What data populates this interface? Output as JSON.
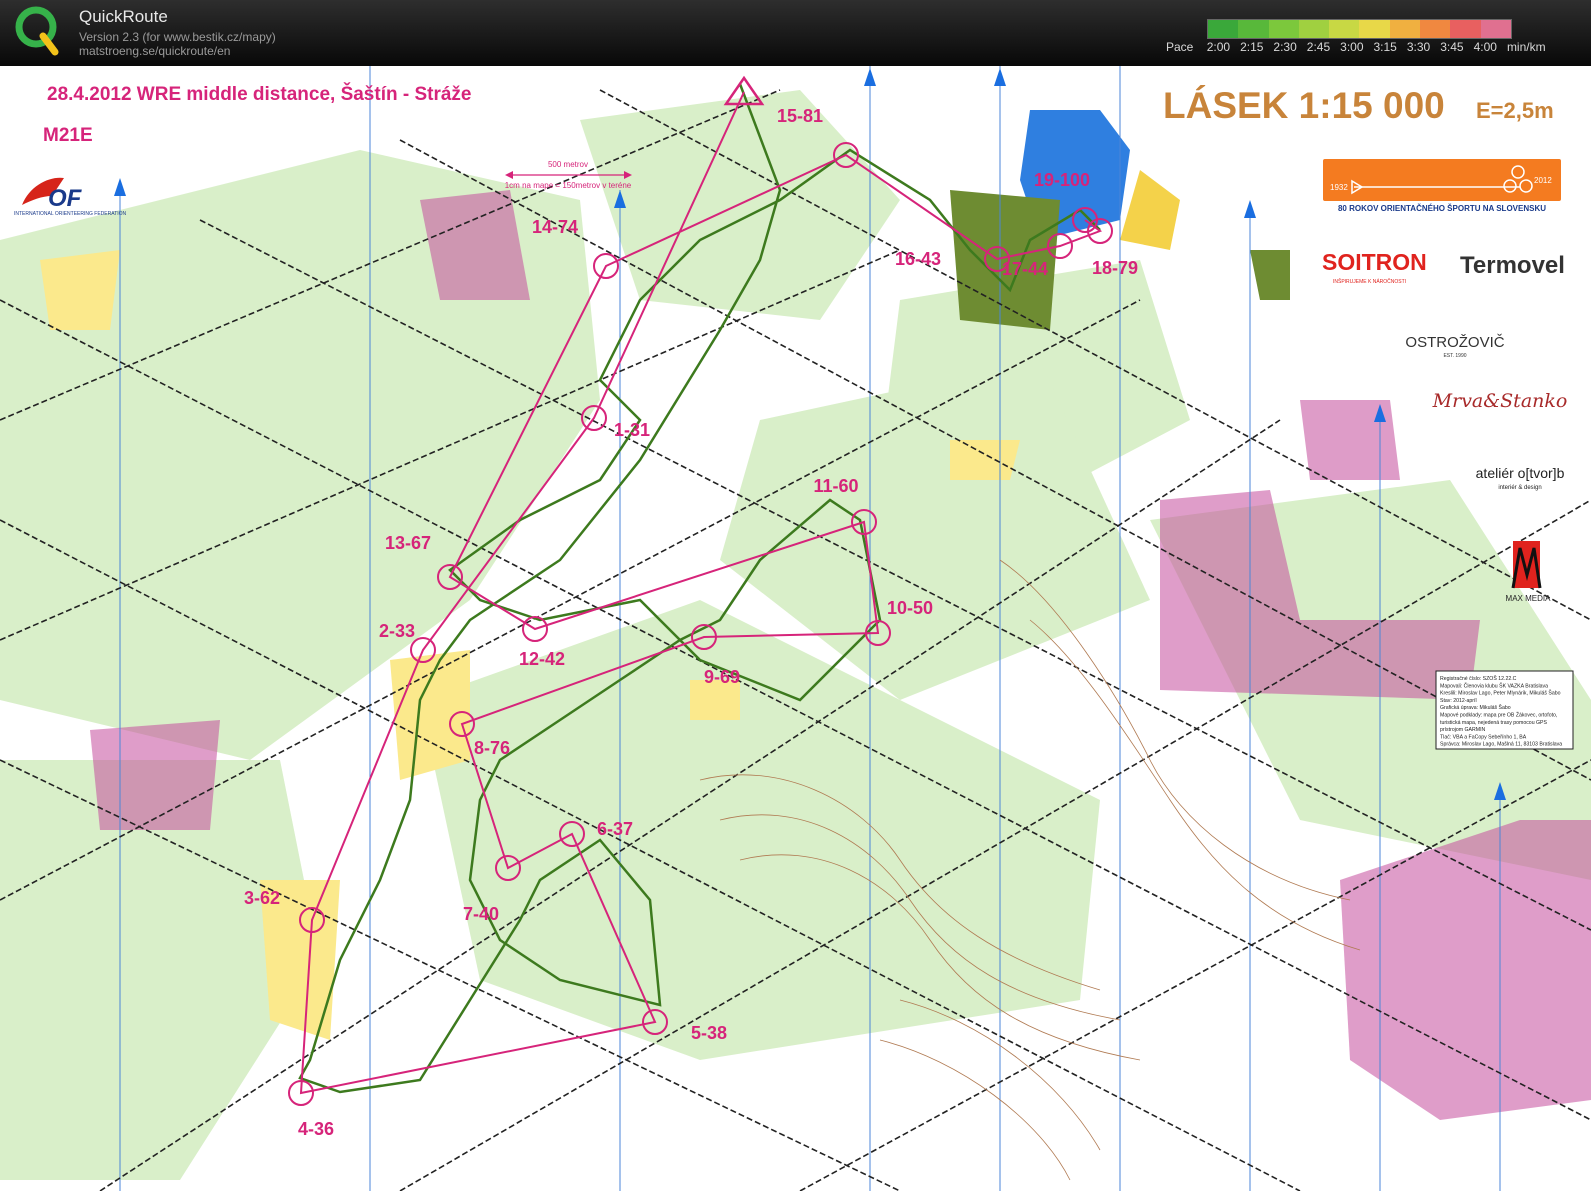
{
  "app": {
    "name": "QuickRoute",
    "version": "Version 2.3  (for www.bestik.cz/mapy)",
    "url": "matstroeng.se/quickroute/en"
  },
  "pace_scale": {
    "label": "Pace",
    "unit": "min/km",
    "ticks": [
      "2:00",
      "2:15",
      "2:30",
      "2:45",
      "3:00",
      "3:15",
      "3:30",
      "3:45",
      "4:00"
    ],
    "colors": [
      "#3aa83a",
      "#58b83a",
      "#7cc83c",
      "#a0d040",
      "#c8d844",
      "#e8d848",
      "#f0b040",
      "#f08840",
      "#e86060",
      "#e07090"
    ]
  },
  "map": {
    "event_title": "28.4.2012  WRE middle distance, Šaštín - Stráže",
    "category": "M21E",
    "map_title": "LÁSEK 1:15 000",
    "equidistance": "E=2,5m",
    "scale_note_top": "500 metrov",
    "scale_note_bottom": "1cm na mape = 150metrov v  teréne",
    "iof_text": "INTERNATIONAL ORIENTEERING FEDERATION",
    "anniversary": {
      "year_start": "1932",
      "year_end": "2012",
      "caption": "80 ROKOV ORIENTAČNÉHO ŠPORTU NA SLOVENSKU"
    },
    "sponsors": {
      "soitron": "SOITRON",
      "soitron_tag": "INŠPIRUJEME K NÁROČNOSTI",
      "termovel": "Termovel",
      "ostrozovic": "OSTROŽOVIČ",
      "ostrozovic_est": "EST. 1990",
      "signature": "Mrva&Stanko",
      "atelier": "ateliér o[tvor]b",
      "atelier_sub": "interiér & design",
      "maxmedia": "MAX MEDIA"
    },
    "info_box": [
      "Registračné číslo: SZOŠ 12.22.C",
      "Mapovali: Členovia klubu ŠK VAZKA Bratislava",
      "Kreslili: Miroslav Lago, Peter Mlynárik, Mikuláš Šabo",
      "Stav: 2012-apríl",
      "Grafická úprava: Mikuláš Šabo",
      "Mapové podklady: mapa pre OB Žákovec, ortofoto,",
      "turistická mapa, nejedená trasy pomocou GPS",
      "prístrojom GARMIN",
      "Tlač: VBA a FaCopy Sebeřínho 1, BA",
      "Správca: Miroslav Lago, Mašlná 11, 83103 Bratislava"
    ],
    "controls": [
      {
        "label": "1-31"
      },
      {
        "label": "2-33"
      },
      {
        "label": "3-62"
      },
      {
        "label": "4-36"
      },
      {
        "label": "5-38"
      },
      {
        "label": "6-37"
      },
      {
        "label": "7-40"
      },
      {
        "label": "8-76"
      },
      {
        "label": "9-69"
      },
      {
        "label": "10-50"
      },
      {
        "label": "11-60"
      },
      {
        "label": "12-42"
      },
      {
        "label": "13-67"
      },
      {
        "label": "14-74"
      },
      {
        "label": "15-81"
      },
      {
        "label": "16-43"
      },
      {
        "label": "17-44"
      },
      {
        "label": "18-79"
      },
      {
        "label": "19-100"
      }
    ],
    "colors": {
      "course": "#d6247a",
      "background": "#ffffff",
      "forest": "#d9efc9",
      "open": "#fbe98c",
      "water": "#2f7fe0",
      "route": "#3d7a1e",
      "title_brown": "#c8843a"
    }
  }
}
